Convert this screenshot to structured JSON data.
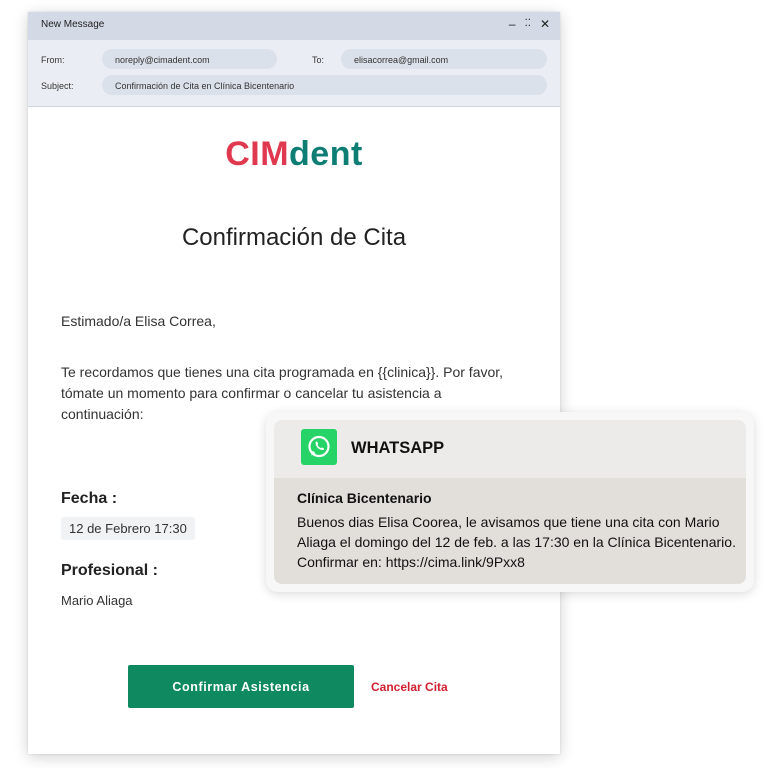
{
  "window": {
    "title": "New Message",
    "controls": [
      "–",
      "⛶",
      "✕"
    ]
  },
  "headers": {
    "from_label": "From:",
    "from_value": "noreply@cimadent.com",
    "to_label": "To:",
    "to_value": "elisacorrea@gmail.com",
    "subject_label": "Subject:",
    "subject_value": "Confirmación de Cita en Clínica Bicentenario"
  },
  "email": {
    "logo": {
      "part1": "CIM",
      "part2": "dent",
      "color1": "#e0394f",
      "color2": "#0e7e75"
    },
    "heading": "Confirmación de Cita",
    "greeting": "Estimado/a Elisa Correa,",
    "paragraph": "Te recordamos que tienes una cita programada en {{clinica}}. Por favor, tómate un momento para confirmar o cancelar tu asistencia a continuación:",
    "date_label": "Fecha :",
    "date_value": "12 de Febrero 17:30",
    "professional_label": "Profesional :",
    "professional_value": "Mario Aliaga",
    "confirm_button": "Confirmar Asistencia",
    "cancel_link": "Cancelar Cita"
  },
  "whatsapp": {
    "title": "WHATSAPP",
    "icon": "whatsapp-icon",
    "sender": "Clínica Bicentenario",
    "message": "Buenos dias Elisa Coorea, le avisamos que tiene una cita con Mario Aliaga el domingo del 12 de feb. a las 17:30 en la Clínica Bicentenario. Confirmar en: https://cima.link/9Pxx8"
  },
  "colors": {
    "accent_green": "#0f8a60",
    "cancel_red": "#d11f2e",
    "whatsapp_green": "#25d366"
  }
}
